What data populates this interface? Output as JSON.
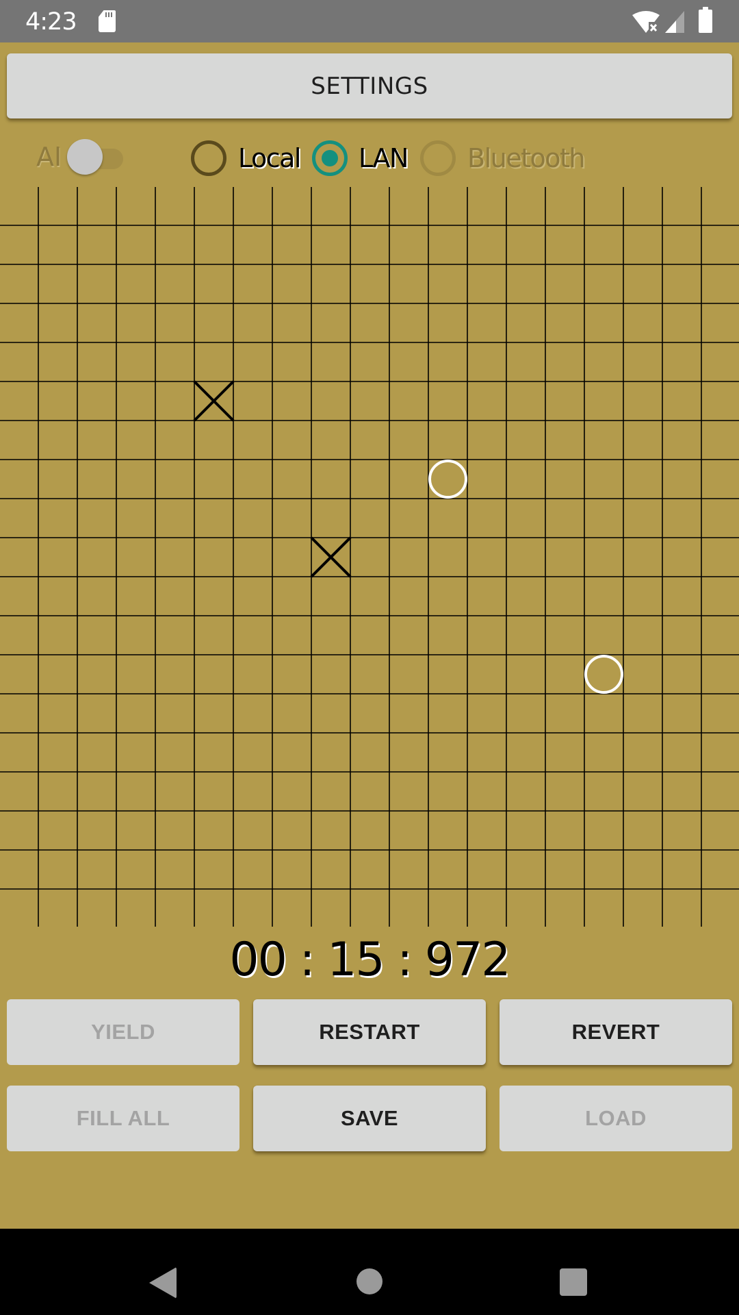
{
  "status_bar": {
    "time": "4:23",
    "icons": [
      "sd-card-icon",
      "wifi-no-internet-icon",
      "cell-signal-icon",
      "battery-icon"
    ]
  },
  "settings_button": {
    "label": "SETTINGS"
  },
  "mode_bar": {
    "ai_toggle": {
      "label": "AI",
      "on": false,
      "enabled": false
    },
    "modes": [
      {
        "label": "Local",
        "selected": false,
        "enabled": true
      },
      {
        "label": "LAN",
        "selected": true,
        "enabled": true
      },
      {
        "label": "Bluetooth",
        "selected": false,
        "enabled": false
      }
    ]
  },
  "board": {
    "line_color": "#000000",
    "background": "#b39b4c",
    "columns": 19,
    "rows": 19,
    "pieces": [
      {
        "type": "X",
        "col": 5,
        "row": 5,
        "color": "#000000"
      },
      {
        "type": "O",
        "col": 11,
        "row": 7,
        "color": "#ffffff"
      },
      {
        "type": "X",
        "col": 8,
        "row": 9,
        "color": "#000000"
      },
      {
        "type": "O",
        "col": 15,
        "row": 12,
        "color": "#ffffff"
      }
    ]
  },
  "timer": {
    "display": "00 : 15 : 972"
  },
  "buttons": {
    "yield": {
      "label": "YIELD",
      "enabled": false
    },
    "restart": {
      "label": "RESTART",
      "enabled": true
    },
    "revert": {
      "label": "REVERT",
      "enabled": true
    },
    "fill_all": {
      "label": "FILL ALL",
      "enabled": false
    },
    "save": {
      "label": "SAVE",
      "enabled": true
    },
    "load": {
      "label": "LOAD",
      "enabled": false
    }
  },
  "nav_bar": {
    "icons": [
      "back-icon",
      "home-icon",
      "recents-icon"
    ]
  },
  "colors": {
    "accent": "#14907f",
    "board": "#b39b4c",
    "button": "#d7d8d7",
    "status_bar": "#757575"
  }
}
